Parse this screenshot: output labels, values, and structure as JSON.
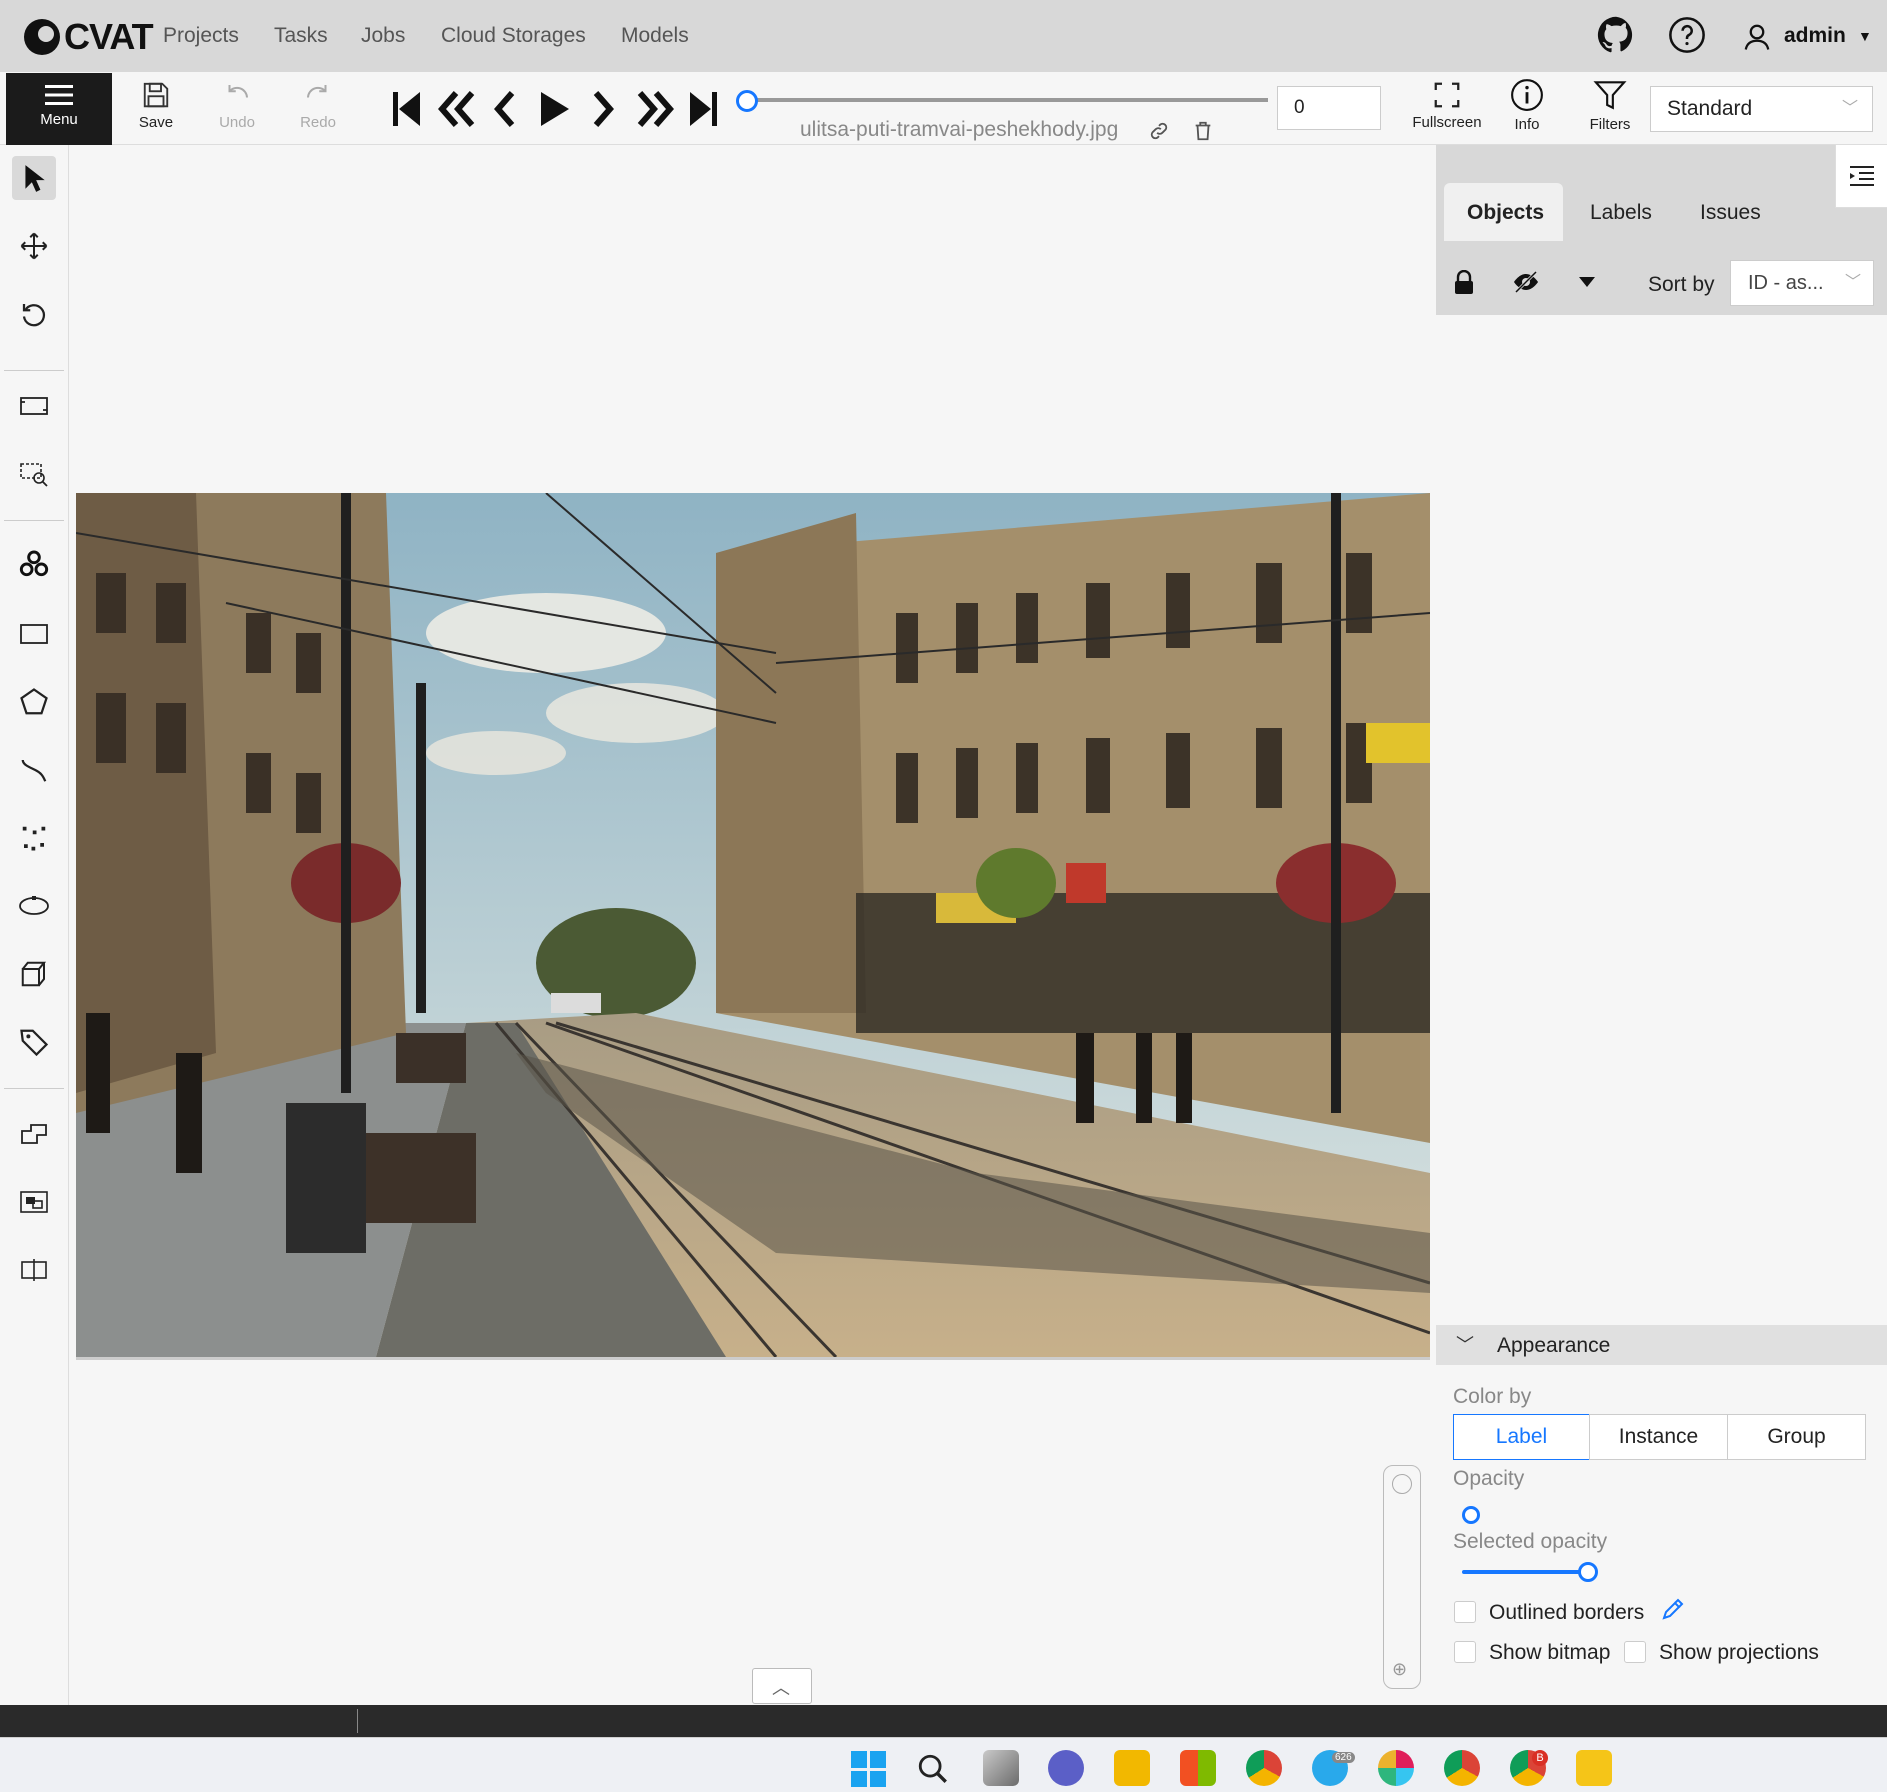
{
  "app": {
    "logo": "CVAT"
  },
  "nav": {
    "links": [
      "Projects",
      "Tasks",
      "Jobs",
      "Cloud Storages",
      "Models"
    ],
    "user": "admin"
  },
  "toolbar": {
    "menu_label": "Menu",
    "save_label": "Save",
    "undo_label": "Undo",
    "redo_label": "Redo",
    "fullscreen_label": "Fullscreen",
    "info_label": "Info",
    "filters_label": "Filters",
    "frame_number": "0",
    "filename": "ulitsa-puti-tramvai-peshekhody.jpg",
    "workspace": "Standard",
    "frame_progress": 0
  },
  "sidebar": {
    "tabs": [
      "Objects",
      "Labels",
      "Issues"
    ],
    "active_tab": "Objects",
    "sort_label": "Sort by",
    "sort_value": "ID - as..."
  },
  "appearance": {
    "title": "Appearance",
    "color_by_label": "Color by",
    "color_by_options": [
      "Label",
      "Instance",
      "Group"
    ],
    "color_by_selected": "Label",
    "opacity_label": "Opacity",
    "opacity_value": 0,
    "selected_opacity_label": "Selected opacity",
    "selected_opacity_value": 100,
    "outlined_borders_label": "Outlined borders",
    "show_bitmap_label": "Show bitmap",
    "show_projections_label": "Show projections"
  },
  "taskbar": {
    "telegram_badge": "626",
    "chrome_badge": "B"
  },
  "colors": {
    "accent": "#1677ff",
    "topbar": "#d8d8d8",
    "menu_bg": "#1b1b1b",
    "status_bar": "#2a2a2a"
  }
}
